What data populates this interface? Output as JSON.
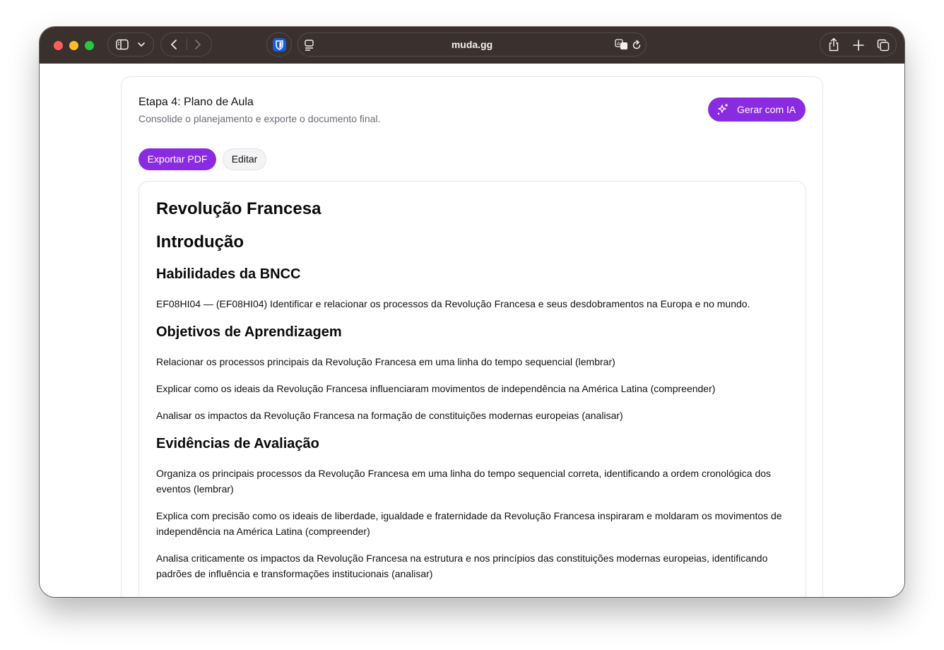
{
  "browser": {
    "url": "muda.gg",
    "colors": {
      "toolbar": "#3a302d",
      "red": "#ff5f57",
      "yellow": "#febc2e",
      "green": "#28c840"
    }
  },
  "card": {
    "title": "Etapa 4: Plano de Aula",
    "subtitle": "Consolide o planejamento e exporte o documento final.",
    "ai_button_label": "Gerar com IA",
    "export_label": "Exportar PDF",
    "edit_label": "Editar",
    "accent_color": "#8a2be2"
  },
  "document": {
    "title": "Revolução Francesa",
    "intro_heading": "Introdução",
    "bncc_heading": "Habilidades da BNCC",
    "bncc_items": [
      "EF08HI04 — (EF08HI04) Identificar e relacionar os processos da Revolução Francesa e seus desdobramentos na Europa e no mundo."
    ],
    "objectives_heading": "Objetivos de Aprendizagem",
    "objectives": [
      "Relacionar os processos principais da Revolução Francesa em uma linha do tempo sequencial (lembrar)",
      "Explicar como os ideais da Revolução Francesa influenciaram movimentos de independência na América Latina (compreender)",
      "Analisar os impactos da Revolução Francesa na formação de constituições modernas europeias (analisar)"
    ],
    "evidence_heading": "Evidências de Avaliação",
    "evidence": [
      "Organiza os principais processos da Revolução Francesa em uma linha do tempo sequencial correta, identificando a ordem cronológica dos eventos (lembrar)",
      "Explica com precisão como os ideais de liberdade, igualdade e fraternidade da Revolução Francesa inspiraram e moldaram os movimentos de independência na América Latina (compreender)",
      "Analisa criticamente os impactos da Revolução Francesa na estrutura e nos princípios das constituições modernas europeias, identificando padrões de influência e transformações institucionais (analisar)"
    ]
  }
}
